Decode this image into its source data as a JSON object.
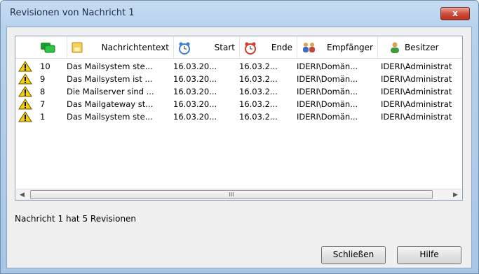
{
  "window": {
    "title": "Revisionen von Nachricht 1",
    "close_label": "x"
  },
  "columns": [
    {
      "label": "",
      "icon": "green-messages-icon"
    },
    {
      "label": "Nachrichtentext",
      "icon": "message-text-icon"
    },
    {
      "label": "Start",
      "icon": "start-clock-icon"
    },
    {
      "label": "Ende",
      "icon": "end-clock-icon"
    },
    {
      "label": "Empfänger",
      "icon": "recipients-icon"
    },
    {
      "label": "Besitzer",
      "icon": "owner-icon"
    }
  ],
  "rows": [
    {
      "status_icon": "warning-icon",
      "rev": "10",
      "text": "Das Mailsystem ste...",
      "start": "16.03.20...",
      "end": "16.03.2...",
      "recipients": "IDERI\\Domän...",
      "owner": "IDERI\\Administrat"
    },
    {
      "status_icon": "warning-icon",
      "rev": "9",
      "text": "Das Mailsystem ist ...",
      "start": "16.03.20...",
      "end": "16.03.2...",
      "recipients": "IDERI\\Domän...",
      "owner": "IDERI\\Administrat"
    },
    {
      "status_icon": "warning-icon",
      "rev": "8",
      "text": "Die Mailserver sind ...",
      "start": "16.03.20...",
      "end": "16.03.2...",
      "recipients": "IDERI\\Domän...",
      "owner": "IDERI\\Administrat"
    },
    {
      "status_icon": "warning-icon",
      "rev": "7",
      "text": "Das Mailgateway st...",
      "start": "16.03.20...",
      "end": "16.03.2...",
      "recipients": "IDERI\\Domän...",
      "owner": "IDERI\\Administrat"
    },
    {
      "status_icon": "warning-icon",
      "rev": "1",
      "text": "Das Mailsystem ste...",
      "start": "16.03.20...",
      "end": "16.03.2...",
      "recipients": "IDERI\\Domän...",
      "owner": "IDERI\\Administrat"
    }
  ],
  "scroll": {
    "left": "◀",
    "right": "▶",
    "grip": "III"
  },
  "status_text": "Nachricht 1 hat 5 Revisionen",
  "buttons": {
    "close": "Schließen",
    "help": "Hilfe"
  },
  "colors": {
    "title_bar": "#b8d1ec",
    "warning": "#f5d000",
    "close_button": "#cf4e3c"
  }
}
